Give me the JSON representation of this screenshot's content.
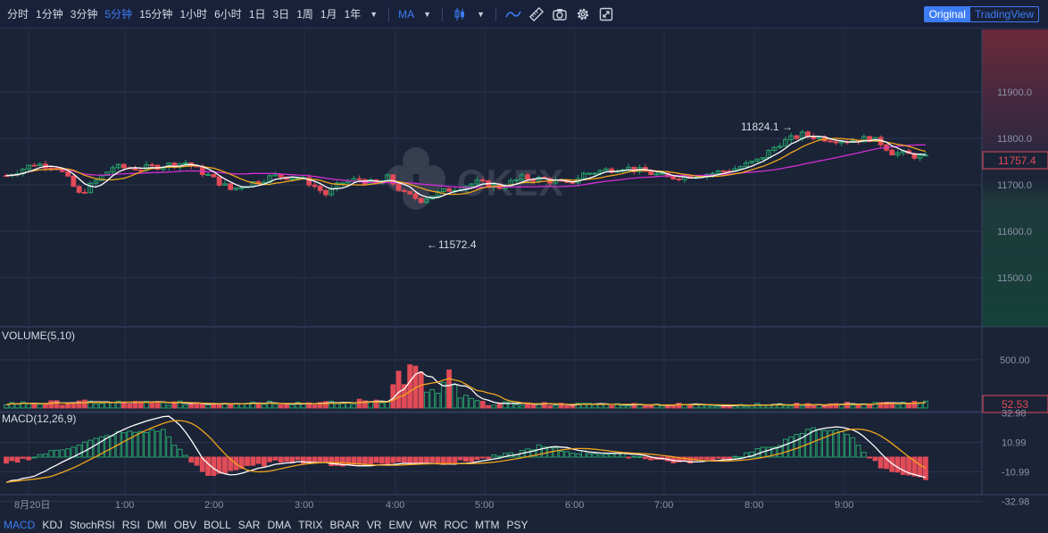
{
  "toolbar": {
    "timeframes": [
      "分时",
      "1分钟",
      "3分钟",
      "5分钟",
      "15分钟",
      "1小时",
      "6小时",
      "1日",
      "3日",
      "1周",
      "1月",
      "1年"
    ],
    "active_timeframe": "5分钟",
    "indicator_menu": "MA",
    "icons": [
      "candle-type-icon",
      "line-icon",
      "ruler-icon",
      "camera-icon",
      "gear-icon",
      "fullscreen-icon"
    ],
    "mode_original": "Original",
    "mode_tradingview": "TradingView"
  },
  "watermark": "OKEX",
  "colors": {
    "background": "#1b2337",
    "up": "#26a26b",
    "down": "#e04b57",
    "ma_white": "#ffffff",
    "ma_orange": "#f0a51c",
    "ma_magenta": "#d12fd3",
    "accent": "#3c7cf3"
  },
  "price_axis": {
    "ticks": [
      "11900.0",
      "11800.0",
      "11700.0",
      "11600.0",
      "11500.0"
    ],
    "current_price": "11757.4"
  },
  "annotations": {
    "high": "11824.1",
    "low": "11572.4"
  },
  "volume_pane": {
    "label": "VOLUME(5,10)",
    "ticks": [
      "500.00"
    ],
    "current": "52.53"
  },
  "macd_pane": {
    "label": "MACD(12,26,9)",
    "ticks": [
      "32.98",
      "10.99",
      "-10.99",
      "-32.98"
    ]
  },
  "time_axis": [
    "8月20日",
    "1:00",
    "2:00",
    "3:00",
    "4:00",
    "5:00",
    "6:00",
    "7:00",
    "8:00",
    "9:00"
  ],
  "indicators": [
    "MACD",
    "KDJ",
    "StochRSI",
    "RSI",
    "DMI",
    "OBV",
    "BOLL",
    "SAR",
    "DMA",
    "TRIX",
    "BRAR",
    "VR",
    "EMV",
    "WR",
    "ROC",
    "MTM",
    "PSY"
  ],
  "active_indicator": "MACD",
  "chart_data": {
    "type": "candlestick",
    "interval": "5分钟",
    "price_range": [
      11450,
      11950
    ],
    "highest_marked": 11824.1,
    "lowest_marked": 11572.4,
    "last_price": 11757.4,
    "close_anchors": [
      [
        0,
        11720
      ],
      [
        5,
        11745
      ],
      [
        9,
        11740
      ],
      [
        11,
        11712
      ],
      [
        13,
        11680
      ],
      [
        15,
        11698
      ],
      [
        19,
        11738
      ],
      [
        24,
        11735
      ],
      [
        28,
        11742
      ],
      [
        32,
        11748
      ],
      [
        36,
        11720
      ],
      [
        40,
        11690
      ],
      [
        44,
        11705
      ],
      [
        48,
        11720
      ],
      [
        52,
        11715
      ],
      [
        54,
        11705
      ],
      [
        57,
        11680
      ],
      [
        60,
        11705
      ],
      [
        63,
        11712
      ],
      [
        66,
        11700
      ],
      [
        68,
        11715
      ],
      [
        71,
        11680
      ],
      [
        74,
        11668
      ],
      [
        76,
        11678
      ],
      [
        79,
        11690
      ],
      [
        84,
        11705
      ],
      [
        88,
        11695
      ],
      [
        92,
        11715
      ],
      [
        96,
        11712
      ],
      [
        100,
        11700
      ],
      [
        103,
        11723
      ],
      [
        106,
        11730
      ],
      [
        110,
        11738
      ],
      [
        114,
        11728
      ],
      [
        118,
        11715
      ],
      [
        122,
        11720
      ],
      [
        126,
        11725
      ],
      [
        130,
        11735
      ],
      [
        134,
        11752
      ],
      [
        138,
        11790
      ],
      [
        142,
        11808
      ],
      [
        146,
        11800
      ],
      [
        150,
        11795
      ],
      [
        154,
        11800
      ],
      [
        156,
        11790
      ],
      [
        158,
        11770
      ],
      [
        161,
        11765
      ],
      [
        164,
        11757.4
      ]
    ],
    "volume_anchors": [
      [
        0,
        50
      ],
      [
        15,
        60
      ],
      [
        35,
        50
      ],
      [
        40,
        70
      ],
      [
        50,
        60
      ],
      [
        60,
        50
      ],
      [
        68,
        100
      ],
      [
        70,
        350
      ],
      [
        73,
        380
      ],
      [
        75,
        200
      ],
      [
        77,
        150
      ],
      [
        79,
        300
      ],
      [
        81,
        120
      ],
      [
        85,
        50
      ],
      [
        100,
        40
      ],
      [
        140,
        35
      ],
      [
        150,
        45
      ],
      [
        164,
        52.53
      ]
    ],
    "macd_anchors": [
      [
        0,
        -5
      ],
      [
        10,
        6
      ],
      [
        20,
        18
      ],
      [
        28,
        20
      ],
      [
        32,
        0
      ],
      [
        36,
        -14
      ],
      [
        40,
        -10
      ],
      [
        50,
        -2
      ],
      [
        60,
        -6
      ],
      [
        70,
        -4
      ],
      [
        80,
        -4
      ],
      [
        90,
        2
      ],
      [
        95,
        8
      ],
      [
        100,
        4
      ],
      [
        110,
        2
      ],
      [
        120,
        -4
      ],
      [
        130,
        0
      ],
      [
        138,
        10
      ],
      [
        144,
        22
      ],
      [
        150,
        18
      ],
      [
        156,
        -8
      ],
      [
        160,
        -14
      ],
      [
        164,
        -16
      ]
    ],
    "volume_axis_max": 600,
    "macd_axis": [
      -40,
      40
    ]
  }
}
